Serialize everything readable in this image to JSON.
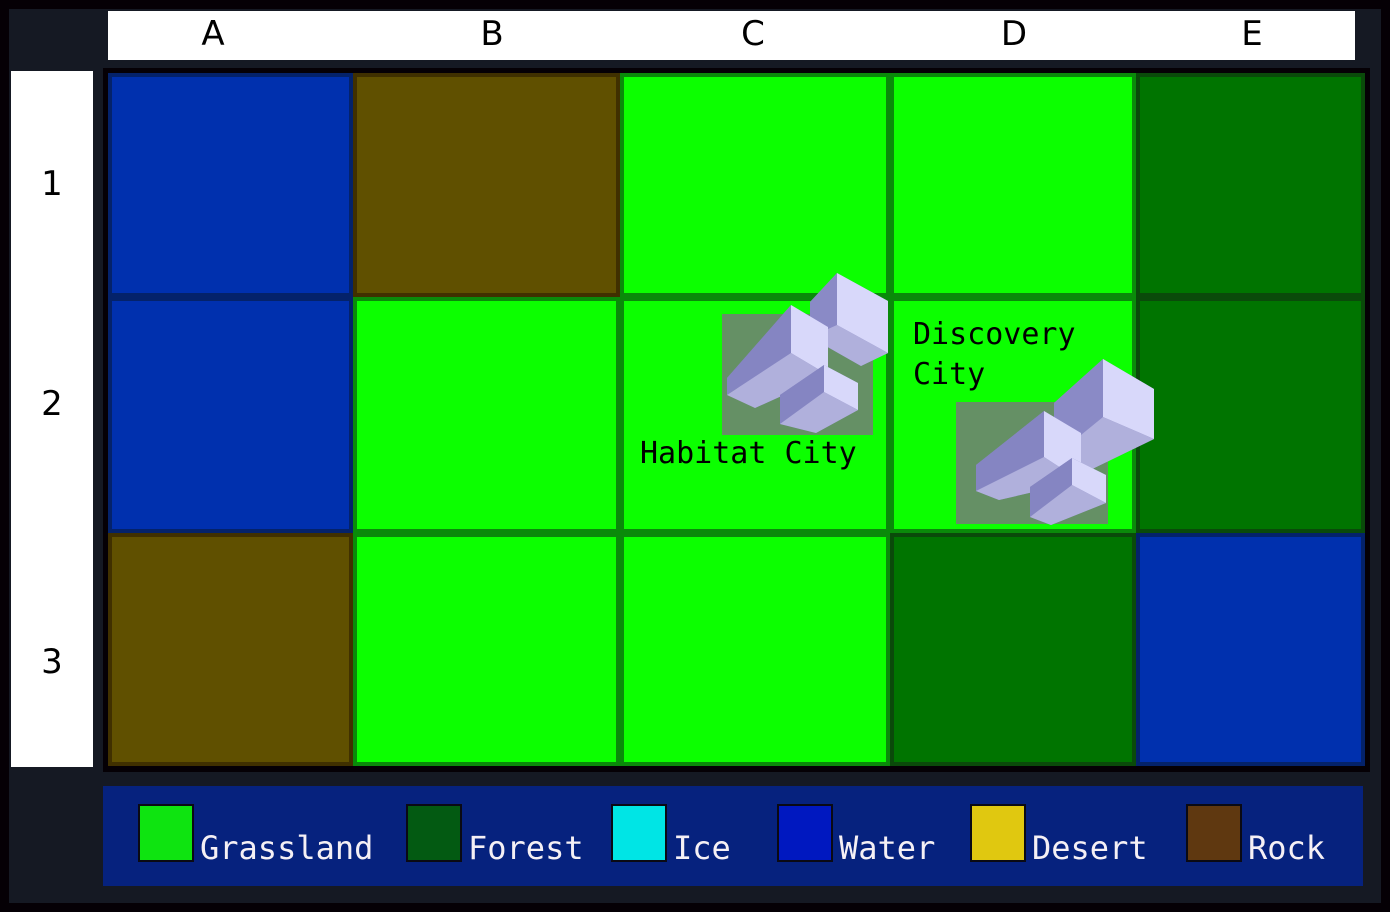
{
  "columns": [
    "A",
    "B",
    "C",
    "D",
    "E"
  ],
  "rows": [
    "1",
    "2",
    "3"
  ],
  "terrain_colors": {
    "Grassland": "#0cff00",
    "Forest": "#007400",
    "Water": "#0030ae",
    "Rock": "#605000",
    "Ice": "#00e5e5",
    "Desert": "#e0c810"
  },
  "grid": [
    [
      "Water",
      "Rock",
      "Grassland",
      "Grassland",
      "Forest"
    ],
    [
      "Water",
      "Grassland",
      "Grassland",
      "Grassland",
      "Forest"
    ],
    [
      "Rock",
      "Grassland",
      "Grassland",
      "Forest",
      "Water"
    ]
  ],
  "cities": [
    {
      "name": "Habitat City",
      "label": "Habitat City",
      "cell": "C2"
    },
    {
      "name": "Discovery City",
      "label": "Discovery\nCity",
      "cell": "D2"
    }
  ],
  "legend": [
    {
      "label": "Grassland",
      "color": "#0ee410"
    },
    {
      "label": "Forest",
      "color": "#035a12"
    },
    {
      "label": "Ice",
      "color": "#00e5e5"
    },
    {
      "label": "Water",
      "color": "#0018c0"
    },
    {
      "label": "Desert",
      "color": "#e0c810"
    },
    {
      "label": "Rock",
      "color": "#5f3810"
    }
  ]
}
